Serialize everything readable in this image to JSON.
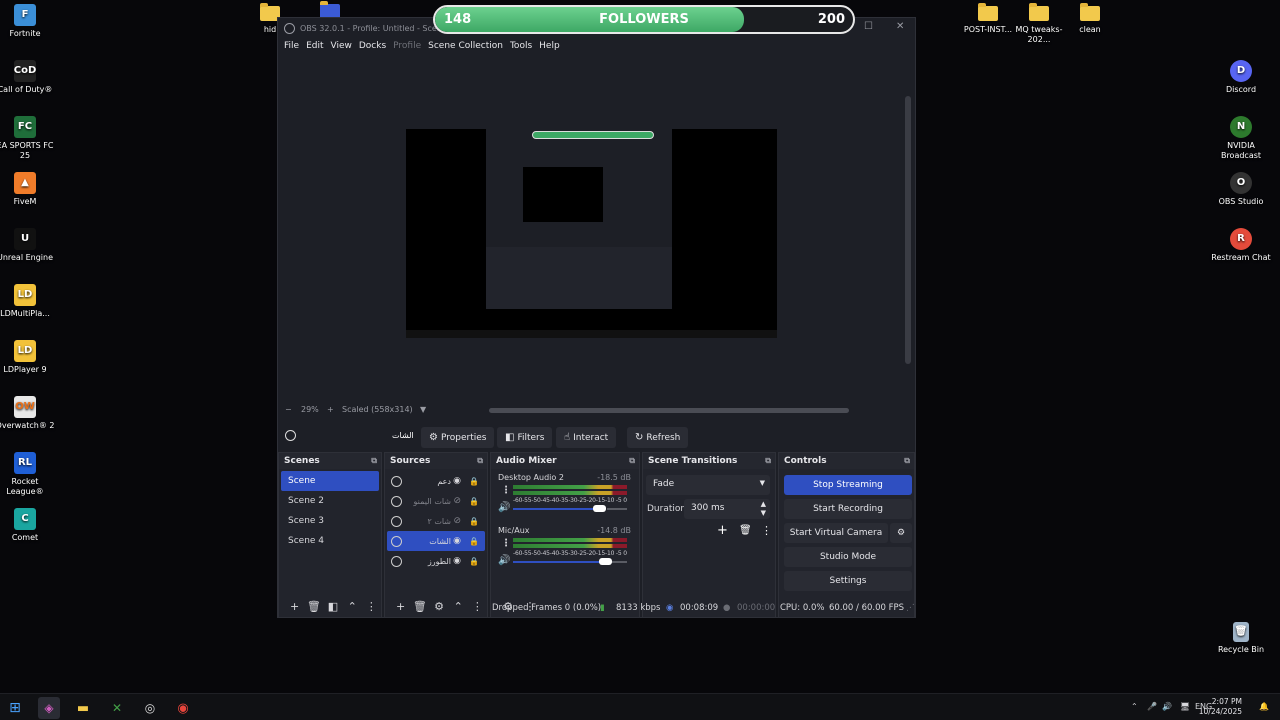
{
  "desktop_left": [
    {
      "label": "Fortnite",
      "color": "#3b8fd8",
      "glyph": "F"
    },
    {
      "label": "Call of Duty®",
      "color": "#222222",
      "glyph": "CoD"
    },
    {
      "label": "EA SPORTS FC 25",
      "color": "#1f6e3a",
      "glyph": "FC"
    },
    {
      "label": "FiveM",
      "color": "#f07c2a",
      "glyph": "▲"
    },
    {
      "label": "Unreal Engine",
      "color": "#111111",
      "glyph": "U"
    },
    {
      "label": "LDMultiPla...",
      "color": "#f2c23a",
      "glyph": "LD"
    },
    {
      "label": "LDPlayer 9",
      "color": "#f2c23a",
      "glyph": "LD"
    },
    {
      "label": "Overwatch® 2",
      "color": "#e8e8e8",
      "glyph": "OW"
    },
    {
      "label": "Rocket League®",
      "color": "#1f5fd6",
      "glyph": "RL"
    },
    {
      "label": "Comet",
      "color": "#1aa6a0",
      "glyph": "C"
    }
  ],
  "desktop_right": [
    {
      "label": "Discord",
      "color": "#5865f2",
      "glyph": "D"
    },
    {
      "label": "NVIDIA Broadcast",
      "color": "#2d7a2d",
      "glyph": "N"
    },
    {
      "label": "OBS Studio",
      "color": "#333333",
      "glyph": "O"
    },
    {
      "label": "Restream Chat",
      "color": "#e44b3b",
      "glyph": "R"
    }
  ],
  "desktop_top_folders": [
    {
      "label": "hid"
    },
    {
      "label": "POST-INST..."
    },
    {
      "label": "MQ tweaks-202..."
    },
    {
      "label": "clean"
    }
  ],
  "recycle_bin": "Recycle Bin",
  "followers": {
    "current": "148",
    "label": "FOLLOWERS",
    "goal": "200",
    "progress": 0.74
  },
  "obs": {
    "title": "OBS 32.0.1 - Profile: Untitled - Scenes:",
    "menu": [
      "File",
      "Edit",
      "View",
      "Docks",
      "Profile",
      "Scene Collection",
      "Tools",
      "Help"
    ],
    "zoom": {
      "minus": "−",
      "value": "29%",
      "plus": "+",
      "scale": "Scaled (558x314)"
    },
    "toolbar": {
      "source_name": "الشات",
      "properties": "Properties",
      "filters": "Filters",
      "interact": "Interact",
      "refresh": "Refresh"
    },
    "docks": {
      "scenes_title": "Scenes",
      "sources_title": "Sources",
      "mixer_title": "Audio Mixer",
      "transitions_title": "Scene Transitions",
      "controls_title": "Controls"
    },
    "scenes": [
      "Scene",
      "Scene 2",
      "Scene 3",
      "Scene 4"
    ],
    "sources": [
      {
        "name": "دعم",
        "hidden": false,
        "active": false
      },
      {
        "name": "شات اليمنو",
        "hidden": true,
        "active": false
      },
      {
        "name": "شات ٢",
        "hidden": true,
        "active": false
      },
      {
        "name": "الشات",
        "hidden": false,
        "active": true
      },
      {
        "name": "الطورز",
        "hidden": false,
        "active": false
      }
    ],
    "mixer": [
      {
        "name": "Desktop Audio 2",
        "db": "-18.5 dB",
        "volume": 0.82
      },
      {
        "name": "Mic/Aux",
        "db": "-14.8 dB",
        "volume": 0.87
      }
    ],
    "meter_ticks": "-60-55-50-45-40-35-30-25-20-15-10 -5  0",
    "transition": {
      "type": "Fade",
      "duration_label": "Duration",
      "duration": "300 ms"
    },
    "controls": [
      "Stop Streaming",
      "Start Recording",
      "Start Virtual Camera",
      "Studio Mode",
      "Settings"
    ],
    "status": {
      "dropped": "Dropped Frames 0 (0.0%)",
      "bitrate": "8133 kbps",
      "stream_time": "00:08:09",
      "rec_time": "00:00:00",
      "cpu": "CPU: 0.0%",
      "fps": "60.00 / 60.00 FPS"
    }
  },
  "taskbar": {
    "lang": "ENG",
    "time": "2:07 PM",
    "date": "10/24/2025"
  }
}
